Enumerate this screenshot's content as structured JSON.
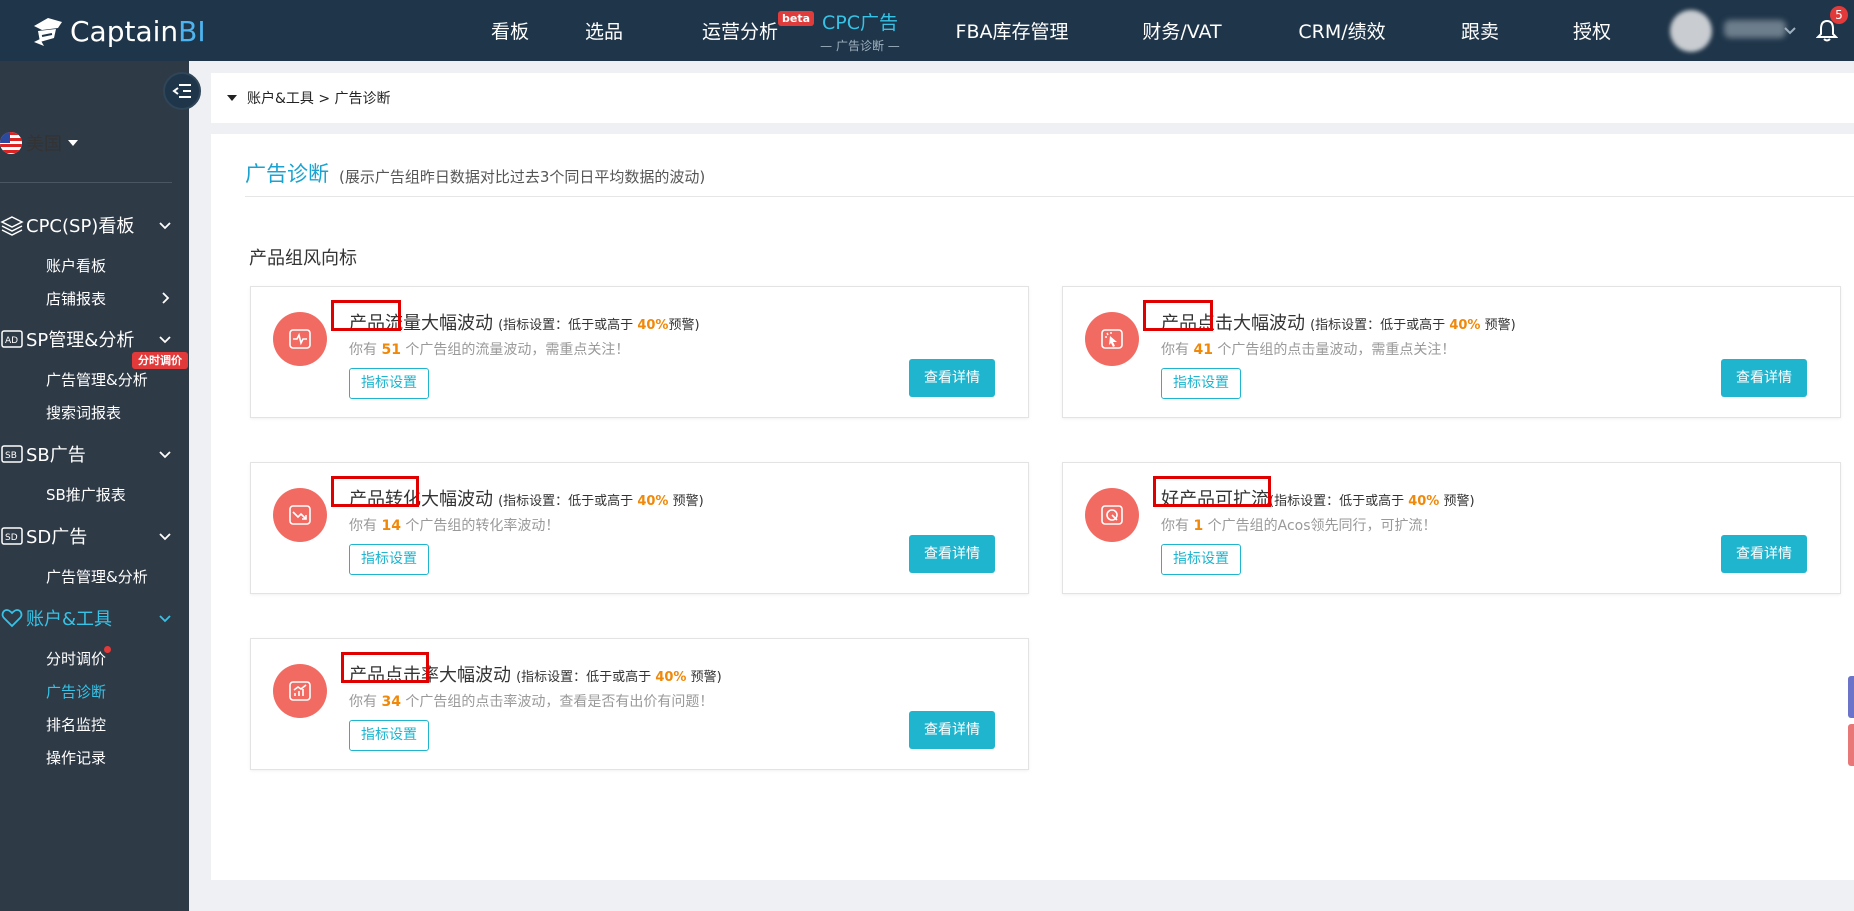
{
  "brand": {
    "name_part1": "Captain",
    "name_part2": "BI"
  },
  "nav": {
    "items": [
      {
        "label": "看板",
        "sub": ""
      },
      {
        "label": "选品",
        "sub": ""
      },
      {
        "label": "运营分析",
        "sub": "",
        "badge": "beta"
      },
      {
        "label": "CPC广告",
        "sub": "— 广告诊断 —"
      },
      {
        "label": "FBA库存管理",
        "sub": ""
      },
      {
        "label": "财务/VAT",
        "sub": ""
      },
      {
        "label": "CRM/绩效",
        "sub": ""
      },
      {
        "label": "跟卖",
        "sub": ""
      },
      {
        "label": "授权",
        "sub": ""
      }
    ],
    "notification_count": "5"
  },
  "sidebar": {
    "country": "美国",
    "sections": [
      {
        "label": "CPC(SP)看板",
        "items": [
          "账户看板",
          "店铺报表"
        ]
      },
      {
        "label": "SP管理&分析",
        "tag": "分时调价",
        "items": [
          "广告管理&分析",
          "搜索词报表"
        ]
      },
      {
        "label": "SB广告",
        "items": [
          "SB推广报表"
        ]
      },
      {
        "label": "SD广告",
        "items": [
          "广告管理&分析"
        ]
      },
      {
        "label": "账户&工具",
        "items": [
          "分时调价",
          "广告诊断",
          "排名监控",
          "操作记录"
        ]
      }
    ]
  },
  "breadcrumb": {
    "text": "账户&工具 > 广告诊断"
  },
  "page": {
    "title": "广告诊断",
    "description": "(展示广告组昨日数据对比过去3个同日平均数据的波动)",
    "group_title": "产品组风向标"
  },
  "cards": [
    {
      "title": "产品流量大幅波动",
      "hint_prefix": "(指标设置：低于或高于",
      "pct": "40%",
      "hint_suffix": "预警)",
      "desc_prefix": "你有",
      "count": "51",
      "desc_suffix": "个广告组的流量波动，需重点关注！",
      "setting_label": "指标设置",
      "detail_label": "查看详情",
      "icon": "pulse-icon"
    },
    {
      "title": "产品点击大幅波动",
      "hint_prefix": "(指标设置：低于或高于",
      "pct": "40%",
      "hint_suffix": "预警)",
      "desc_prefix": "你有",
      "count": "41",
      "desc_suffix": "个广告组的点击量波动，需重点关注！",
      "setting_label": "指标设置",
      "detail_label": "查看详情",
      "icon": "cursor-click-icon"
    },
    {
      "title": "产品转化大幅波动",
      "hint_prefix": "(指标设置：低于或高于",
      "pct": "40%",
      "hint_suffix": "预警)",
      "desc_prefix": "你有",
      "count": "14",
      "desc_suffix": "个广告组的转化率波动！",
      "setting_label": "指标设置",
      "detail_label": "查看详情",
      "icon": "trend-down-icon"
    },
    {
      "title": "好产品可扩流",
      "hint_prefix": "(指标设置：低于或高于",
      "pct": "40%",
      "hint_suffix": "预警)",
      "desc_prefix": "你有",
      "count": "1",
      "desc_suffix": "个广告组的Acos领先同行，可扩流！",
      "setting_label": "指标设置",
      "detail_label": "查看详情",
      "icon": "target-icon"
    },
    {
      "title": "产品点击率大幅波动",
      "hint_prefix": "(指标设置：低于或高于",
      "pct": "40%",
      "hint_suffix": "预警)",
      "desc_prefix": "你有",
      "count": "34",
      "desc_suffix": "个广告组的点击率波动，查看是否有出价有问题！",
      "setting_label": "指标设置",
      "detail_label": "查看详情",
      "icon": "bar-chart-icon"
    }
  ]
}
